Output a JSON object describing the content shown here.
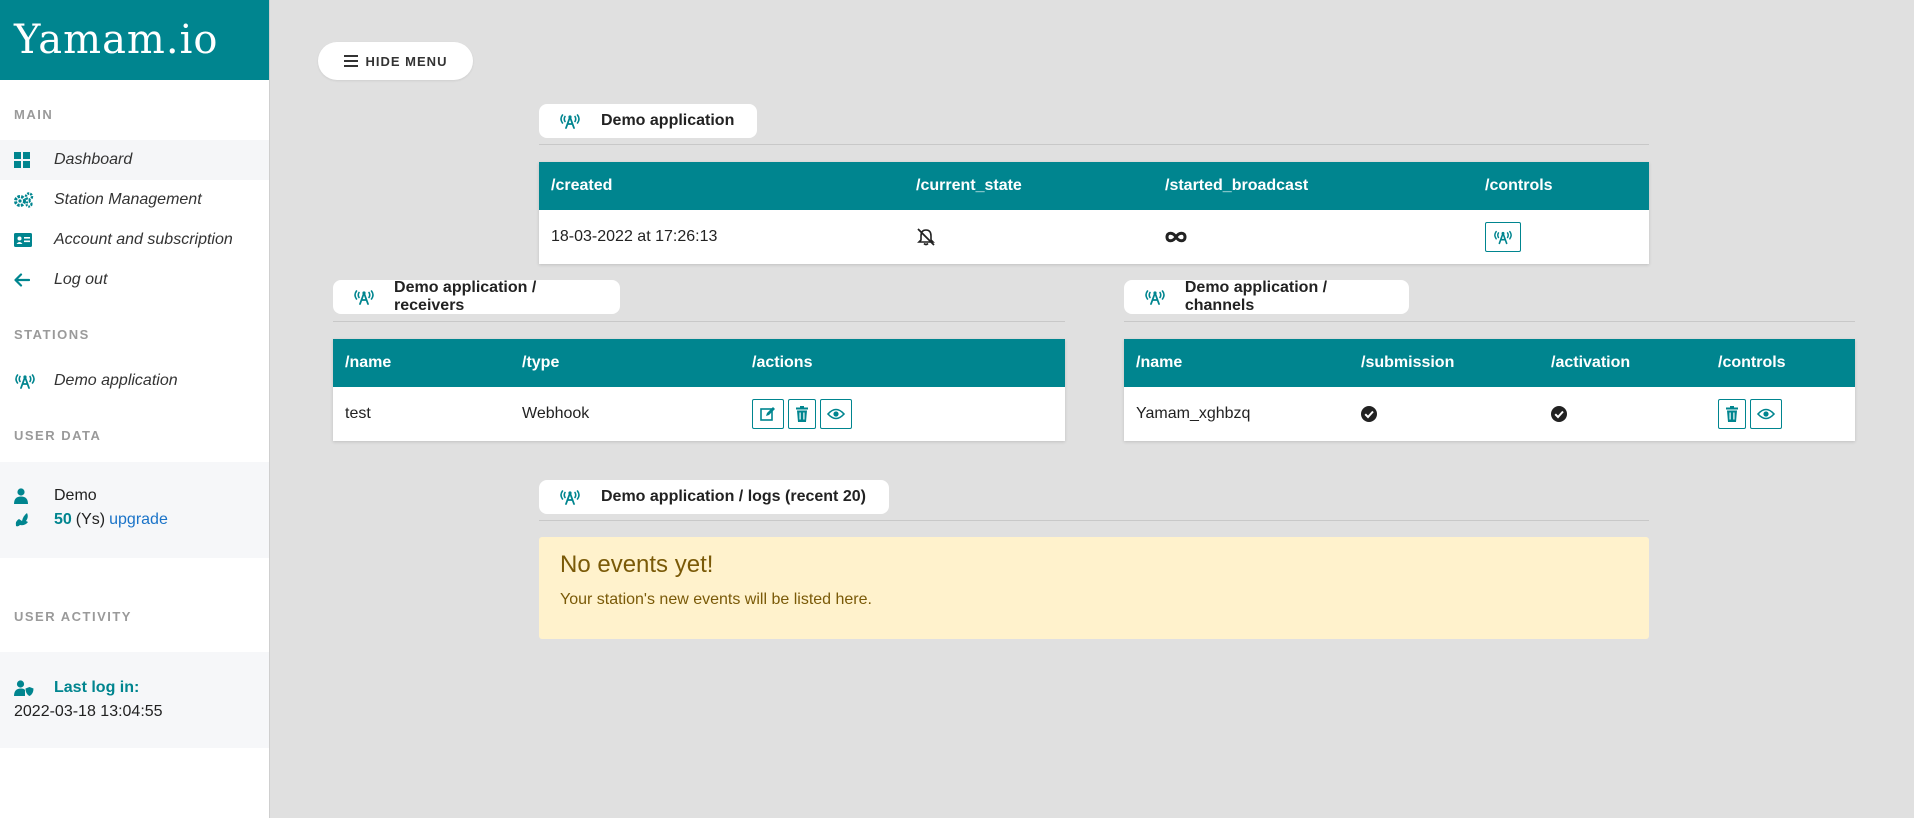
{
  "brand": {
    "title": "Yamam.io"
  },
  "header": {
    "hide_menu_label": "HIDE MENU"
  },
  "sidebar": {
    "main_title": "MAIN",
    "main_items": [
      {
        "label": "Dashboard",
        "icon": "dashboard-icon"
      },
      {
        "label": "Station Management",
        "icon": "gears-icon"
      },
      {
        "label": "Account and subscription",
        "icon": "id-card-icon"
      },
      {
        "label": "Log out",
        "icon": "arrow-left-icon"
      }
    ],
    "stations_title": "STATIONS",
    "stations": [
      {
        "label": "Demo application",
        "icon": "broadcast-tower-icon"
      }
    ],
    "user_data_title": "USER DATA",
    "user": {
      "name": "Demo",
      "credits": "50",
      "credits_unit": "(Ys)",
      "upgrade_label": "upgrade"
    },
    "user_activity_title": "USER ACTIVITY",
    "activity": {
      "last_login_label": "Last log in:",
      "last_login_value": "2022-03-18 13:04:55"
    }
  },
  "station_panel": {
    "title": "Demo application",
    "columns": [
      "/created",
      "/current_state",
      "/started_broadcast",
      "/controls"
    ],
    "row": {
      "created": "18-03-2022 at 17:26:13",
      "current_state_icon": "bell-slash-icon",
      "started_broadcast_icon": "infinity-icon",
      "controls_icon": "broadcast-tower-icon"
    }
  },
  "receivers_panel": {
    "title": "Demo application / receivers",
    "columns": [
      "/name",
      "/type",
      "/actions"
    ],
    "rows": [
      {
        "name": "test",
        "type": "Webhook"
      }
    ]
  },
  "channels_panel": {
    "title": "Demo application / channels",
    "columns": [
      "/name",
      "/submission",
      "/activation",
      "/controls"
    ],
    "rows": [
      {
        "name": "Yamam_xghbzq"
      }
    ]
  },
  "logs_panel": {
    "title": "Demo application / logs (recent 20)",
    "empty_title": "No events yet!",
    "empty_text": "Your station's new events will be listed here."
  },
  "colors": {
    "accent": "#00858f",
    "background": "#e0e0e0",
    "alert_bg": "#fff2cc",
    "alert_text": "#7a5a08"
  }
}
